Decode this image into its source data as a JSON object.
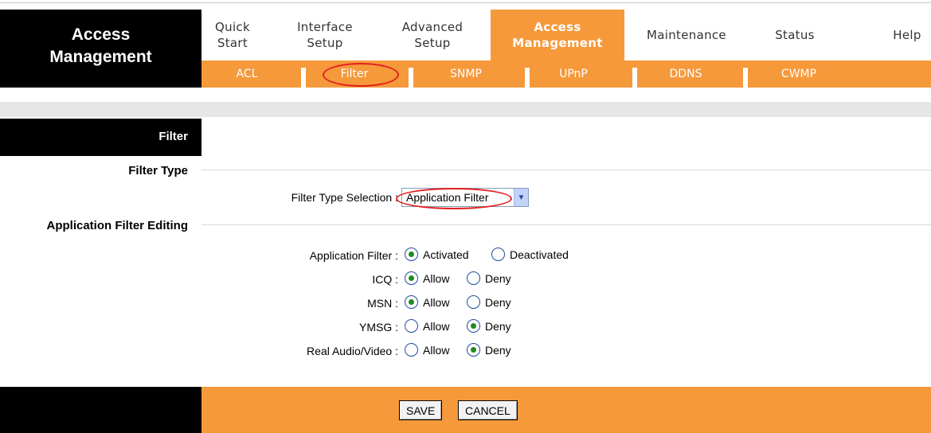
{
  "brand": {
    "line1": "Access",
    "line2": "Management"
  },
  "nav": [
    {
      "line1": "Quick",
      "line2": "Start"
    },
    {
      "line1": "Interface",
      "line2": "Setup"
    },
    {
      "line1": "Advanced",
      "line2": "Setup"
    },
    {
      "line1": "Access",
      "line2": "Management"
    },
    {
      "line1": "Maintenance",
      "line2": ""
    },
    {
      "line1": "Status",
      "line2": ""
    },
    {
      "line1": "Help",
      "line2": ""
    }
  ],
  "subnav": [
    "ACL",
    "Filter",
    "SNMP",
    "UPnP",
    "DDNS",
    "CWMP"
  ],
  "sections": {
    "filter": "Filter",
    "filter_type": "Filter Type",
    "app_filter_editing": "Application Filter Editing"
  },
  "filter_type": {
    "label": "Filter Type Selection :",
    "selected": "Application Filter"
  },
  "app_filter": {
    "label": "Application Filter :",
    "options": [
      "Activated",
      "Deactivated"
    ],
    "selected": "Activated"
  },
  "apps": [
    {
      "label": "ICQ :",
      "selected": "Allow"
    },
    {
      "label": "MSN :",
      "selected": "Allow"
    },
    {
      "label": "YMSG :",
      "selected": "Deny"
    },
    {
      "label": "Real Audio/Video :",
      "selected": "Deny"
    }
  ],
  "app_options": [
    "Allow",
    "Deny"
  ],
  "buttons": {
    "save": "SAVE",
    "cancel": "CANCEL"
  },
  "colors": {
    "accent": "#f5993b",
    "highlight": "#e32020"
  }
}
